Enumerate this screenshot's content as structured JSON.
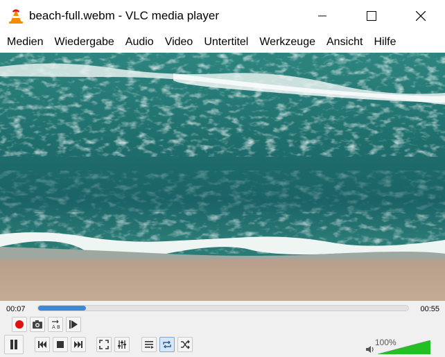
{
  "window": {
    "title": "beach-full.webm - VLC media player",
    "controls": [
      "minimize",
      "maximize",
      "close"
    ]
  },
  "menu": [
    {
      "label": "Medien"
    },
    {
      "label": "Wiedergabe"
    },
    {
      "label": "Audio"
    },
    {
      "label": "Video"
    },
    {
      "label": "Untertitel"
    },
    {
      "label": "Werkzeuge"
    },
    {
      "label": "Ansicht"
    },
    {
      "label": "Hilfe"
    }
  ],
  "video": {
    "icon": "video-frame-ocean-beach-aerial",
    "colors": {
      "deep": "#1d6a6a",
      "shallow": "#2c7f7a",
      "foam": "#e8f2f0",
      "sand": "#c4ab92"
    }
  },
  "playback": {
    "elapsed": "00:07",
    "total": "00:55",
    "progress": 0.13,
    "volume_label": "100%",
    "volume_level": 1.0
  },
  "colors": {
    "seek_fill": "#3f88d6",
    "record": "#e01010",
    "volume_green": "#22c022",
    "toggle_active": "#d6e6f6"
  }
}
